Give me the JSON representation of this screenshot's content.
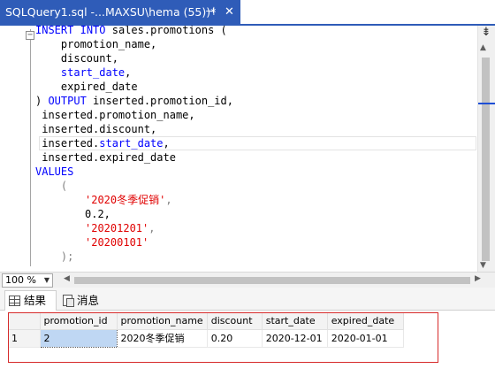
{
  "document_tab": {
    "title": "SQLQuery1.sql -...MAXSU\\hema (55))*",
    "pin_glyph": "⊣",
    "close_glyph": "✕"
  },
  "editor": {
    "line1": {
      "kw1": "INSERT",
      "kw2": "INTO",
      "rest": " sales.promotions ("
    },
    "line2": "    promotion_name,",
    "line3": "    discount,",
    "line4_pre": "    ",
    "line4_kw": "start_date",
    "line4_post": ",",
    "line5": "    expired_date",
    "line6": {
      "paren": ") ",
      "kw": "OUTPUT",
      "rest": " inserted.promotion_id,"
    },
    "line7": " inserted.promotion_name,",
    "line8": " inserted.discount,",
    "line9": {
      "pre": " inserted.",
      "kw": "start_date",
      "post": ","
    },
    "line10": " inserted.expired_date",
    "line11": "VALUES",
    "line12": "    (",
    "line13": {
      "str": "'2020冬季促销'",
      "post": ","
    },
    "line14": "0.2,",
    "line15": {
      "str": "'20201201'",
      "post": ","
    },
    "line16": {
      "str": "'20200101'"
    },
    "line17": "    );"
  },
  "zoom": {
    "value": "100 %"
  },
  "results_tabs": [
    {
      "label": "结果",
      "icon": "results-grid-icon"
    },
    {
      "label": "消息",
      "icon": "messages-icon"
    }
  ],
  "results": {
    "columns": [
      "promotion_id",
      "promotion_name",
      "discount",
      "start_date",
      "expired_date"
    ],
    "rows": [
      {
        "num": "1",
        "cells": [
          "2",
          "2020冬季促销",
          "0.20",
          "2020-12-01",
          "2020-01-01"
        ]
      }
    ]
  },
  "colors": {
    "tab_active": "#2f5cb8",
    "keyword": "#0000ff",
    "string": "#e00000",
    "highlight_box": "#d62a2a",
    "selected_cell": "#bfd7f3"
  }
}
